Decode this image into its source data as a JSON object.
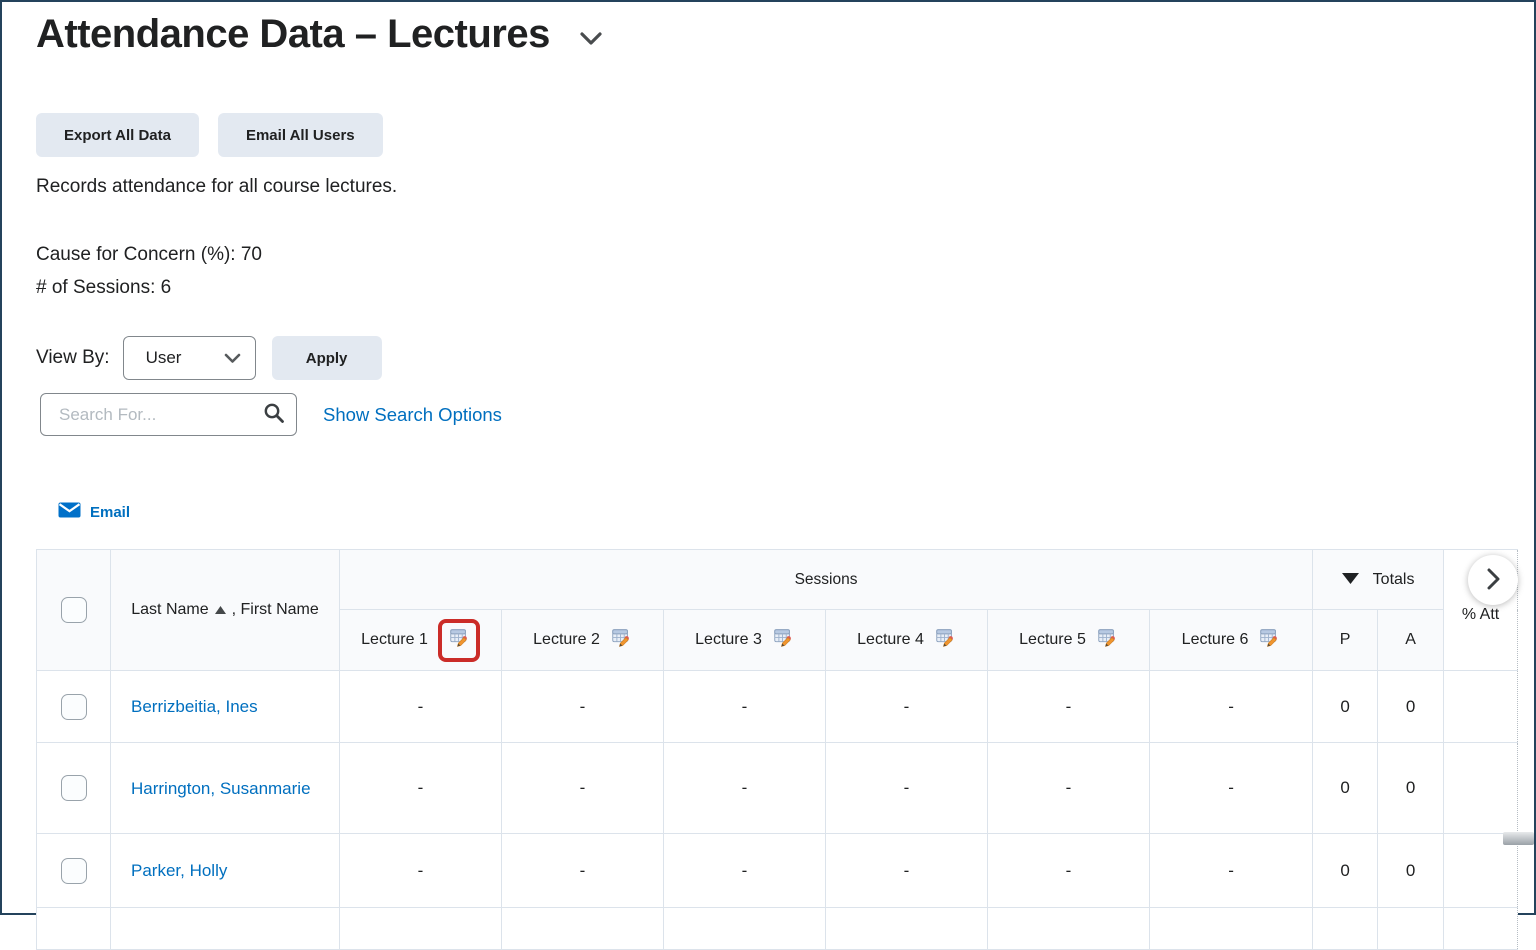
{
  "page": {
    "title": "Attendance Data – Lectures",
    "description": "Records attendance for all course lectures.",
    "cause_for_concern": "Cause for Concern (%): 70",
    "num_sessions": "# of Sessions: 6"
  },
  "toolbar": {
    "export_label": "Export All Data",
    "email_all_label": "Email All Users"
  },
  "filters": {
    "view_by_label": "View By:",
    "view_by_value": "User",
    "apply_label": "Apply",
    "search_placeholder": "Search For...",
    "search_value": "",
    "show_search_options_label": "Show Search Options"
  },
  "table_toolbar": {
    "email_label": "Email"
  },
  "table": {
    "sessions_header": "Sessions",
    "totals_header": "Totals",
    "pct_attendance_header": "% Att",
    "name_header_pre": "Last Name",
    "name_header_post": ", First Name",
    "present_header": "P",
    "absent_header": "A",
    "lectures": [
      "Lecture 1",
      "Lecture 2",
      "Lecture 3",
      "Lecture 4",
      "Lecture 5",
      "Lecture 6"
    ],
    "rows": [
      {
        "name": "Berrizbeitia, Ines",
        "sessions": [
          "-",
          "-",
          "-",
          "-",
          "-",
          "-"
        ],
        "present": "0",
        "absent": "0"
      },
      {
        "name": "Harrington, Susanmarie",
        "sessions": [
          "-",
          "-",
          "-",
          "-",
          "-",
          "-"
        ],
        "present": "0",
        "absent": "0"
      },
      {
        "name": "Parker, Holly",
        "sessions": [
          "-",
          "-",
          "-",
          "-",
          "-",
          "-"
        ],
        "present": "0",
        "absent": "0"
      }
    ]
  },
  "icons": {
    "title_caret": "chevron-down",
    "search": "magnifier",
    "email": "envelope",
    "name_sort": "triangle-up",
    "totals_marker": "triangle-down",
    "session_edit": "grid-with-pencil",
    "scroll_next": "chevron-right"
  },
  "colors": {
    "link_blue": "#006fbf",
    "button_bg": "#e3e9f1",
    "annotation_red": "#cb2c28",
    "frame_navy": "#24435c",
    "table_border": "#dce3eb",
    "header_bg": "#f9fafc"
  }
}
